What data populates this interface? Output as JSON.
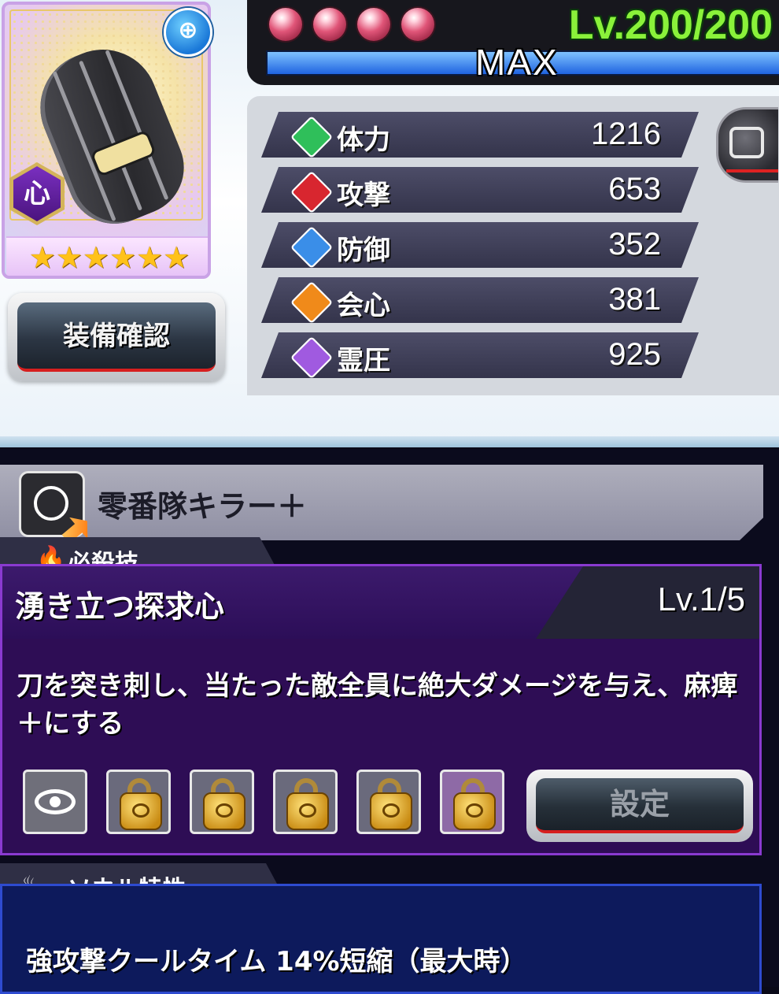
{
  "card": {
    "attribute_badge": "心",
    "stars": [
      "★",
      "★",
      "★",
      "★",
      "★",
      "★"
    ],
    "zoom_icon": "magnifier-plus-icon"
  },
  "equip_button": {
    "label": "装備確認"
  },
  "level": {
    "text": "Lv.200/200",
    "exp_label": "MAX",
    "exp_percent": 100,
    "orbs": 4
  },
  "stats": [
    {
      "label": "体力",
      "value": "1216",
      "icon": "hp-icon",
      "color": "#2fbf5a"
    },
    {
      "label": "攻撃",
      "value": "653",
      "icon": "attack-icon",
      "color": "#d8262f"
    },
    {
      "label": "防御",
      "value": "352",
      "icon": "defense-icon",
      "color": "#3a8ee8"
    },
    {
      "label": "会心",
      "value": "381",
      "icon": "critical-icon",
      "color": "#f08a1a"
    },
    {
      "label": "霊圧",
      "value": "925",
      "icon": "reiatsu-icon",
      "color": "#a05ae0"
    }
  ],
  "passive": {
    "name": "零番隊キラー＋"
  },
  "special_move": {
    "tab_label": "必殺技",
    "name": "湧き立つ探求心",
    "level": "Lv.1/5",
    "description": "刀を突き刺し、当たった敵全員に絶大ダメージを与え、麻痺＋にする",
    "set_button": "設定"
  },
  "soul": {
    "tab_label": "ソウル特性",
    "text": "強攻撃クールタイム 14%短縮（最大時）"
  }
}
